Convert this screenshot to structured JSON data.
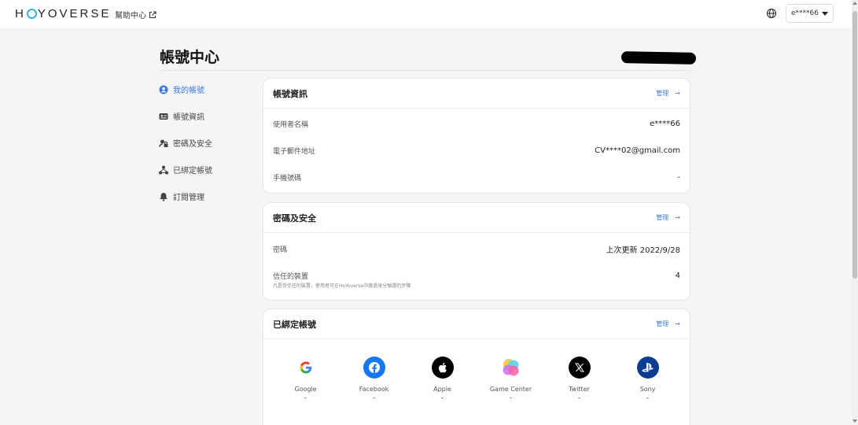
{
  "header": {
    "logo_text": "HOYOVERSE",
    "logo_before": "H",
    "logo_after": "YOVERSE",
    "help_label": "幫助中心",
    "user_label": "e****66"
  },
  "page": {
    "title": "帳號中心"
  },
  "sidebar": {
    "items": [
      {
        "label": "我的帳號",
        "icon": "user-circle-icon",
        "active": true
      },
      {
        "label": "帳號資訊",
        "icon": "id-card-icon",
        "active": false
      },
      {
        "label": "密碼及安全",
        "icon": "lock-shield-icon",
        "active": false
      },
      {
        "label": "已綁定帳號",
        "icon": "network-icon",
        "active": false
      },
      {
        "label": "訂閱管理",
        "icon": "bell-icon",
        "active": false
      }
    ]
  },
  "account_info": {
    "title": "帳號資訊",
    "manage_label": "管理",
    "rows": [
      {
        "label": "使用者名稱",
        "value": "e****66"
      },
      {
        "label": "電子郵件地址",
        "value": "CV****02@gmail.com"
      },
      {
        "label": "手機號碼",
        "value": "-"
      }
    ]
  },
  "security": {
    "title": "密碼及安全",
    "manage_label": "管理",
    "password_label": "密碼",
    "password_value": "上次更新 2022/9/28",
    "devices_label": "信任的裝置",
    "devices_value": "4",
    "devices_hint": "凡是受信任的裝置，使用者可在HoYoverse中跳過身分驗證的步驟"
  },
  "linked": {
    "title": "已綁定帳號",
    "manage_label": "管理",
    "providers": [
      {
        "name": "Google",
        "value": "-",
        "icon": "google-icon",
        "color": "#ffffff"
      },
      {
        "name": "Facebook",
        "value": "-",
        "icon": "facebook-icon",
        "color": "#1877f2"
      },
      {
        "name": "Apple",
        "value": "-",
        "icon": "apple-icon",
        "color": "#000000"
      },
      {
        "name": "Game Center",
        "value": "-",
        "icon": "game-center-icon",
        "color": "#ff5fa2"
      },
      {
        "name": "Twitter",
        "value": "-",
        "icon": "x-twitter-icon",
        "color": "#000000"
      },
      {
        "name": "Sony",
        "value": "-",
        "icon": "playstation-icon",
        "color": "#0a3d91"
      }
    ]
  },
  "colors": {
    "accent": "#3a78e0",
    "background": "#f5f5f7",
    "logo_ring": "#3bb3d9"
  }
}
